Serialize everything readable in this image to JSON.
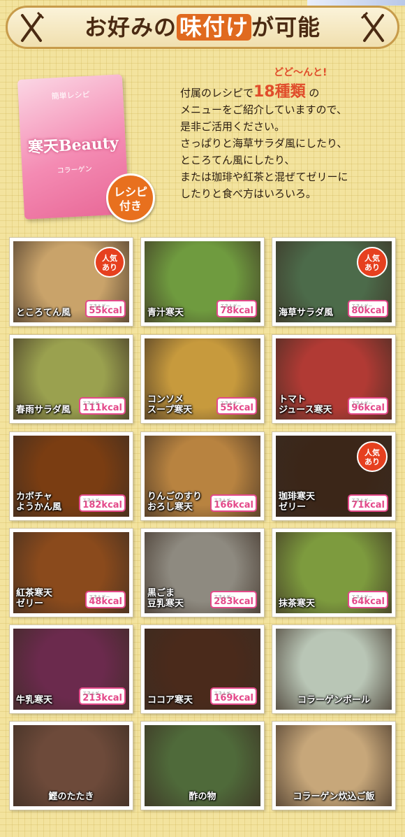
{
  "header": {
    "title_pre": "お好みの",
    "title_accent": "味付け",
    "title_post": "が可能"
  },
  "book": {
    "small_label": "簡単レシピ",
    "title": "寒天Beauty",
    "subtitle": "コラーゲン"
  },
  "recipe_badge": {
    "line1": "レシピ",
    "line2": "付き"
  },
  "recipe_text": {
    "ruby": "どど〜んと!",
    "line1_pre": "付属のレシピで",
    "line1_big": "18種類",
    "line1_post": "の",
    "line2": "メニューをご紹介していますので、",
    "line3": "是非ご活用ください。",
    "line4": "さっぱりと海草サラダ風にしたり、",
    "line5": "ところてん風にしたり、",
    "line6": "または珈琲や紅茶と混ぜてゼリーに",
    "line7": "したりと食べ方はいろいろ。"
  },
  "popular_label": {
    "line1": "人気",
    "line2": "あり"
  },
  "kcal_caption": "エネルギー",
  "menu": [
    {
      "name": "ところてん風",
      "kcal": "55kcal",
      "popular": true,
      "color": "#c9a36a"
    },
    {
      "name": "青汁寒天",
      "kcal": "78kcal",
      "popular": false,
      "color": "#6f9b3f"
    },
    {
      "name": "海草サラダ風",
      "kcal": "80kcal",
      "popular": true,
      "color": "#4c6b4a"
    },
    {
      "name": "春雨サラダ風",
      "kcal": "111kcal",
      "popular": false,
      "color": "#9aa14f"
    },
    {
      "name": "コンソメ\nスープ寒天",
      "kcal": "55kcal",
      "popular": false,
      "color": "#c79a3d"
    },
    {
      "name": "トマト\nジュース寒天",
      "kcal": "96kcal",
      "popular": false,
      "color": "#b13a34"
    },
    {
      "name": "カボチャ\nようかん風",
      "kcal": "182kcal",
      "popular": false,
      "color": "#7a3d12"
    },
    {
      "name": "りんごのすり\nおろし寒天",
      "kcal": "166kcal",
      "popular": false,
      "color": "#b88340"
    },
    {
      "name": "珈琲寒天\nゼリー",
      "kcal": "71kcal",
      "popular": true,
      "color": "#3b2618"
    },
    {
      "name": "紅茶寒天\nゼリー",
      "kcal": "48kcal",
      "popular": false,
      "color": "#8a4a1c"
    },
    {
      "name": "黒ごま\n豆乳寒天",
      "kcal": "283kcal",
      "popular": false,
      "color": "#8e8a80"
    },
    {
      "name": "抹茶寒天",
      "kcal": "64kcal",
      "popular": false,
      "color": "#7d9b3e"
    },
    {
      "name": "牛乳寒天",
      "kcal": "213kcal",
      "popular": false,
      "color": "#6b2a4d"
    },
    {
      "name": "ココア寒天",
      "kcal": "169kcal",
      "popular": false,
      "color": "#4a2a1b"
    },
    {
      "name": "コラーゲンボール",
      "kcal": "",
      "popular": false,
      "color": "#b9c6b6"
    },
    {
      "name": "鰹のたたき",
      "kcal": "",
      "popular": false,
      "color": "#6d4a3a"
    },
    {
      "name": "酢の物",
      "kcal": "",
      "popular": false,
      "color": "#4f6a3a"
    },
    {
      "name": "コラーゲン炊込ご飯",
      "kcal": "",
      "popular": false,
      "color": "#c7a77a"
    }
  ]
}
